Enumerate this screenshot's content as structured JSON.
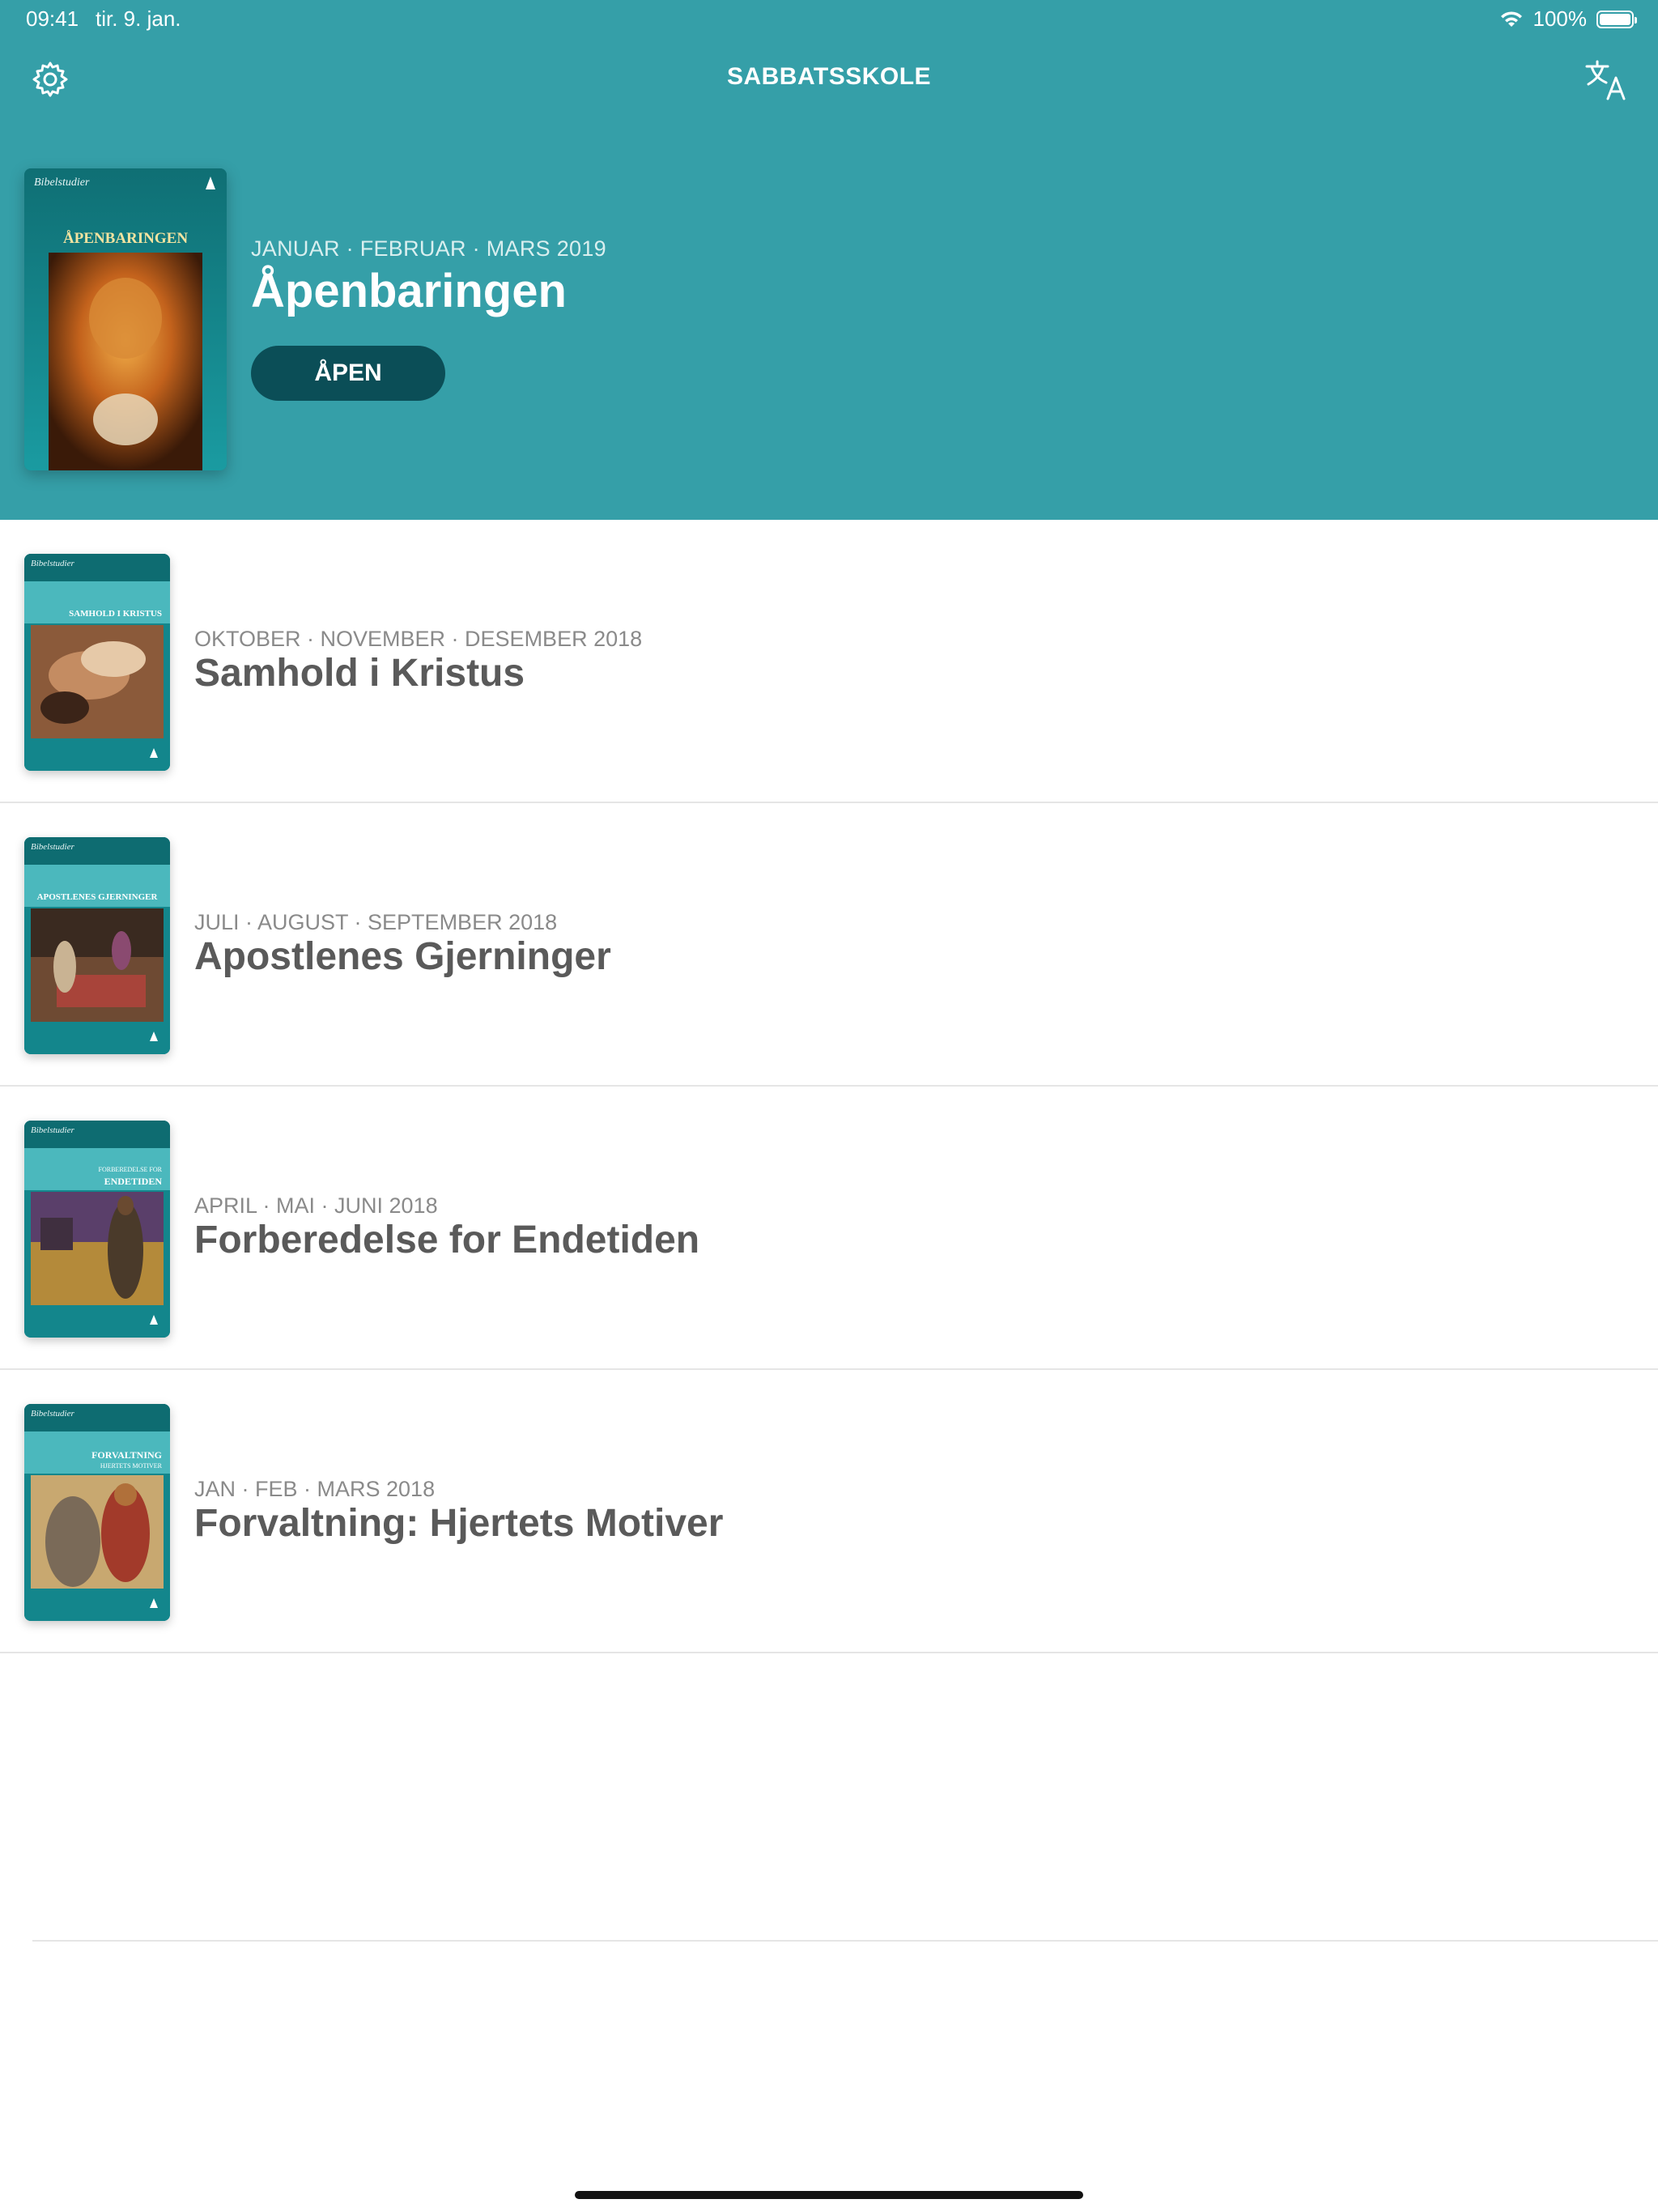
{
  "status_bar": {
    "time": "09:41",
    "date": "tir. 9. jan.",
    "battery": "100%"
  },
  "nav": {
    "title": "SABBATSSKOLE",
    "settings_icon": "gear-icon",
    "translate_icon": "translate-icon"
  },
  "featured": {
    "dates": "JANUAR · FEBRUAR · MARS 2019",
    "title": "Åpenbaringen",
    "open_label": "ÅPEN",
    "cover_brand": "Bibelstudier",
    "cover_title": "ÅPENBARINGEN"
  },
  "quarterlies": [
    {
      "dates": "OKTOBER · NOVEMBER · DESEMBER 2018",
      "title": "Samhold i Kristus",
      "cover_brand": "Bibelstudier",
      "cover_title": "SAMHOLD I KRISTUS"
    },
    {
      "dates": "JULI · AUGUST · SEPTEMBER 2018",
      "title": "Apostlenes Gjerninger",
      "cover_brand": "Bibelstudier",
      "cover_title": "APOSTLENES GJERNINGER"
    },
    {
      "dates": "APRIL · MAI · JUNI 2018",
      "title": "Forberedelse for Endetiden",
      "cover_brand": "Bibelstudier",
      "cover_subtitle": "FORBEREDELSE FOR",
      "cover_title": "ENDETIDEN"
    },
    {
      "dates": "JAN · FEB · MARS 2018",
      "title": "Forvaltning: Hjertets Motiver",
      "cover_brand": "Bibelstudier",
      "cover_title": "FORVALTNING",
      "cover_subtitle": "HJERTETS MOTIVER"
    }
  ],
  "colors": {
    "header": "#359fa8",
    "open_button": "#0b4e57",
    "title_text": "#5a5a5a",
    "date_text": "#8a8a8a"
  }
}
